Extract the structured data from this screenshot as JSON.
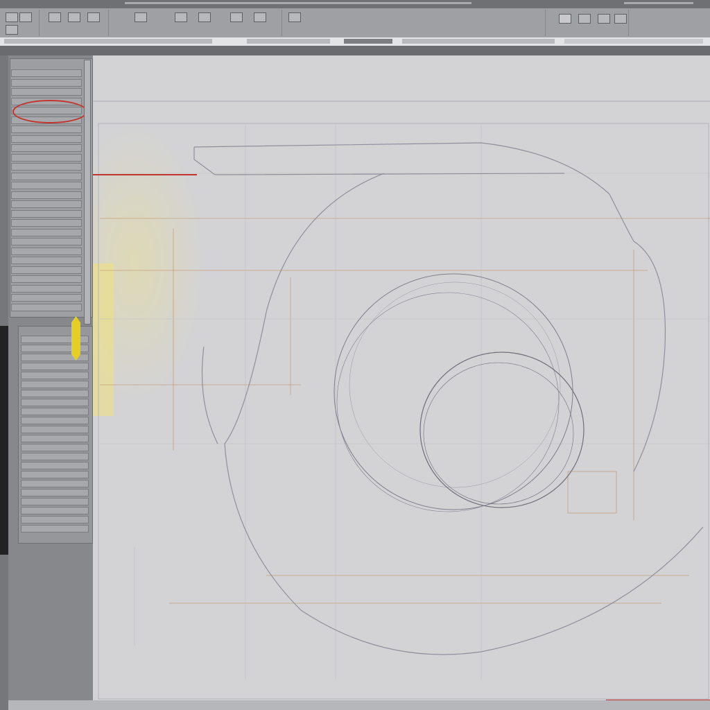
{
  "colors": {
    "canvas_bg": "#d3d3d5",
    "outline": "#9a9aa6",
    "construction": "#c49068",
    "annotation_red": "#c4322c",
    "highlight_yellow": "#e5cf25"
  },
  "ribbon": {
    "icons": [
      "select-icon",
      "pan-icon",
      "zoom-icon",
      "line-tool-icon",
      "arc-tool-icon",
      "circle-tool-icon",
      "dimension-icon",
      "layer-icon",
      "view-icon",
      "settings-icon"
    ]
  },
  "panel": {
    "scrollbar": "vertical"
  },
  "canvas": {
    "annotations": [
      "construction-lines",
      "section-outline",
      "inner-ring",
      "bore-circle"
    ]
  }
}
